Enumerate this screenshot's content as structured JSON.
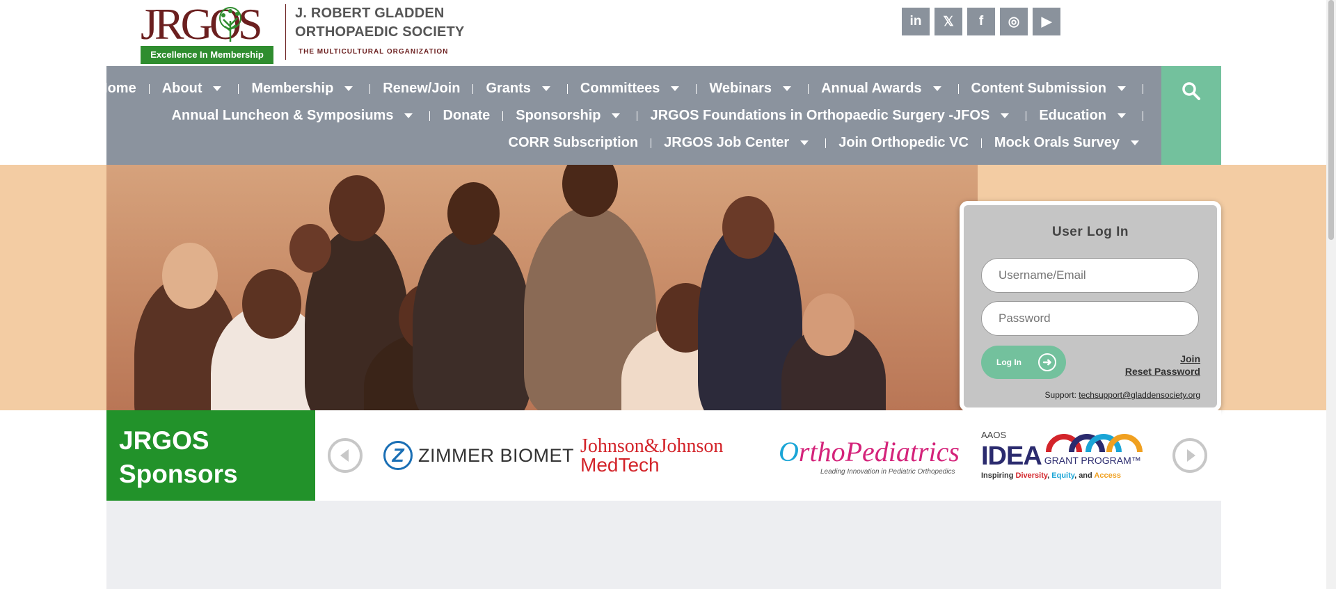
{
  "header": {
    "logo_letters": "JRGOS",
    "logo_tagline": "Excellence In Membership",
    "org_name_line1": "J. ROBERT GLADDEN",
    "org_name_line2": "ORTHOPAEDIC SOCIETY",
    "org_subtitle": "THE MULTICULTURAL ORGANIZATION",
    "social": [
      {
        "icon": "linkedin-icon",
        "glyph": "in"
      },
      {
        "icon": "x-icon",
        "glyph": "𝕏"
      },
      {
        "icon": "facebook-icon",
        "glyph": "f"
      },
      {
        "icon": "instagram-icon",
        "glyph": "◎"
      },
      {
        "icon": "youtube-icon",
        "glyph": "▶"
      }
    ]
  },
  "nav": {
    "row1": [
      {
        "label": "Home",
        "dropdown": false
      },
      {
        "label": "About",
        "dropdown": true
      },
      {
        "label": "Membership",
        "dropdown": true
      },
      {
        "label": "Renew/Join",
        "dropdown": false
      },
      {
        "label": "Grants",
        "dropdown": true
      },
      {
        "label": "Committees",
        "dropdown": true
      },
      {
        "label": "Webinars",
        "dropdown": true
      },
      {
        "label": "Annual Awards",
        "dropdown": true
      },
      {
        "label": "Content Submission",
        "dropdown": true
      }
    ],
    "row2": [
      {
        "label": "Annual Luncheon & Symposiums",
        "dropdown": true
      },
      {
        "label": "Donate",
        "dropdown": false
      },
      {
        "label": "Sponsorship",
        "dropdown": true
      },
      {
        "label": "JRGOS Foundations in Orthopaedic Surgery -JFOS",
        "dropdown": true
      },
      {
        "label": "Education",
        "dropdown": true
      }
    ],
    "row3": [
      {
        "label": "CORR Subscription",
        "dropdown": false
      },
      {
        "label": "JRGOS Job Center",
        "dropdown": true
      },
      {
        "label": "Join Orthopedic VC",
        "dropdown": false
      },
      {
        "label": "Mock Orals Survey",
        "dropdown": true
      }
    ],
    "search_icon": "search-icon"
  },
  "login": {
    "title": "User Log In",
    "username_placeholder": "Username/Email",
    "password_placeholder": "Password",
    "login_button": "Log In",
    "join_link": "Join",
    "reset_link": "Reset Password",
    "support_label": "Support:",
    "support_email": "techsupport@gladdensociety.org"
  },
  "sponsors": {
    "title_line1": "JRGOS",
    "title_line2": "Sponsors",
    "zimmer": "ZIMMER BIOMET",
    "jj_line1": "Johnson&Johnson",
    "jj_line2": "MedTech",
    "ortho_main_o": "O",
    "ortho_main_rest": "rthoPediatrics",
    "ortho_tag": "Leading Innovation in Pediatric Orthopedics",
    "idea_aaos": "AAOS",
    "idea_big": "IDEA",
    "idea_gp": "GRANT PROGRAM™",
    "idea_sub_prefix": "Inspiring ",
    "idea_sub_d": "Diversity",
    "idea_sub_mid": ", ",
    "idea_sub_eq": "Equity",
    "idea_sub_and": ", and ",
    "idea_sub_ac": "Access"
  },
  "colors": {
    "nav_bg": "#8b939e",
    "accent_green": "#73c19d",
    "sponsor_green": "#22922a",
    "brand_maroon": "#6b1f1f",
    "hero_bg": "#f3cca3"
  }
}
